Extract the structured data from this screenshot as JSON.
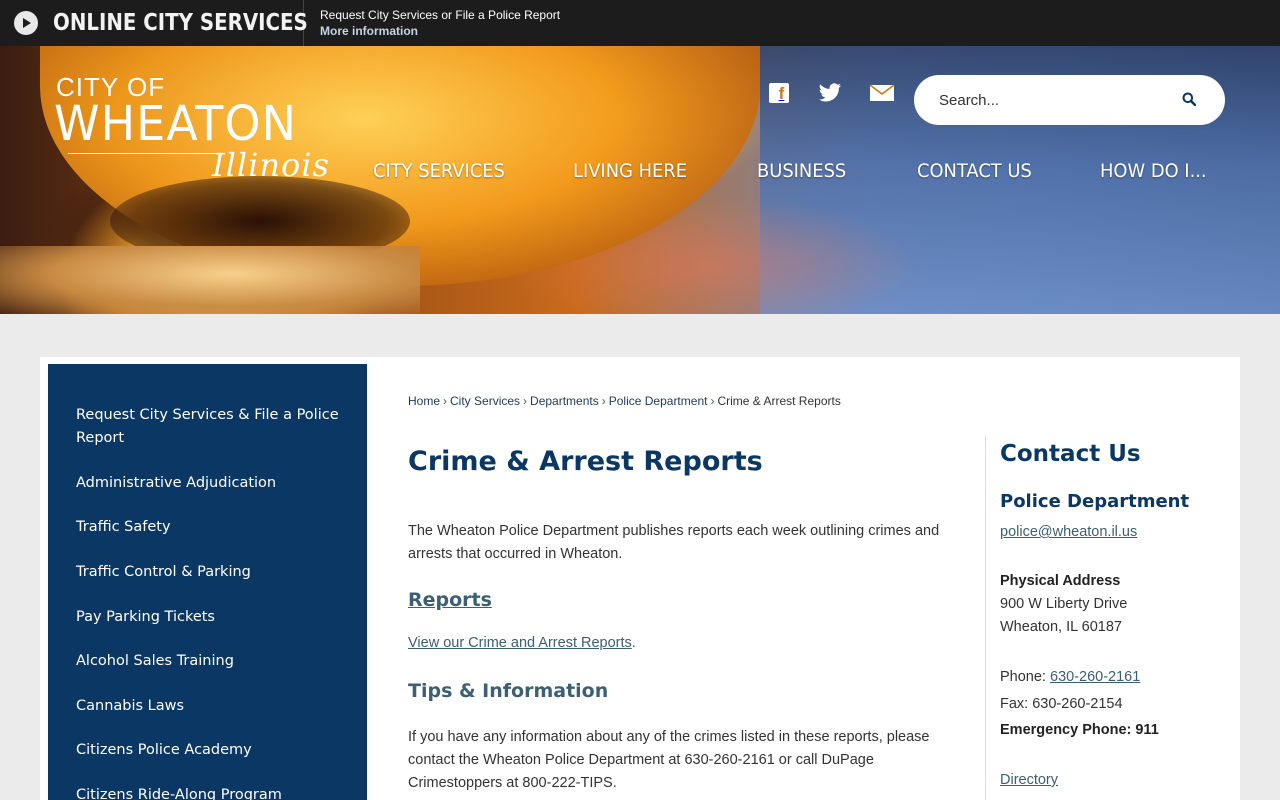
{
  "topbar": {
    "title": "ONLINE CITY SERVICES",
    "announcement": "Request City Services or File a Police Report",
    "more_info": "More information"
  },
  "logo": {
    "city_of": "CITY OF",
    "wheaton": "WHEATON",
    "illinois": "Illinois"
  },
  "social": {
    "facebook": "facebook-icon",
    "twitter": "twitter-icon",
    "email": "mail-icon"
  },
  "search": {
    "placeholder": "Search..."
  },
  "nav": {
    "items": [
      "CITY SERVICES",
      "LIVING HERE",
      "BUSINESS",
      "CONTACT US",
      "HOW DO I..."
    ]
  },
  "sidebar": {
    "items": [
      "Request City Services & File a Police Report",
      "Administrative Adjudication",
      "Traffic Safety",
      "Traffic Control & Parking",
      "Pay Parking Tickets",
      "Alcohol Sales Training",
      "Cannabis Laws",
      "Citizens Police Academy",
      "Citizens Ride-Along Program"
    ]
  },
  "breadcrumb": {
    "items": [
      "Home",
      "City Services",
      "Departments",
      "Police Department"
    ],
    "current": "Crime & Arrest Reports"
  },
  "main": {
    "title": "Crime & Arrest Reports",
    "intro": "The Wheaton Police Department publishes reports each week outlining crimes and arrests that occurred in Wheaton.",
    "reports_heading": "Reports",
    "reports_link": "View our Crime and Arrest Reports",
    "tips_heading": "Tips & Information",
    "tips_text": "If you have any information about any of the crimes listed in these reports, please contact the Wheaton Police Department at 630-260-2161 or call DuPage Crimestoppers at 800-222-TIPS."
  },
  "contact": {
    "title": "Contact Us",
    "department": "Police Department",
    "email": "police@wheaton.il.us",
    "address_label": "Physical Address",
    "address_line1": "900 W Liberty Drive",
    "address_line2": "Wheaton, IL 60187",
    "phone_label": "Phone: ",
    "phone": "630-260-2161",
    "fax": "Fax: 630-260-2154",
    "emergency": "Emergency Phone: 911",
    "directory": "Directory"
  },
  "colors": {
    "navy": "#0a3764",
    "link": "#3c5f73",
    "topbar": "#1c1c1c"
  }
}
